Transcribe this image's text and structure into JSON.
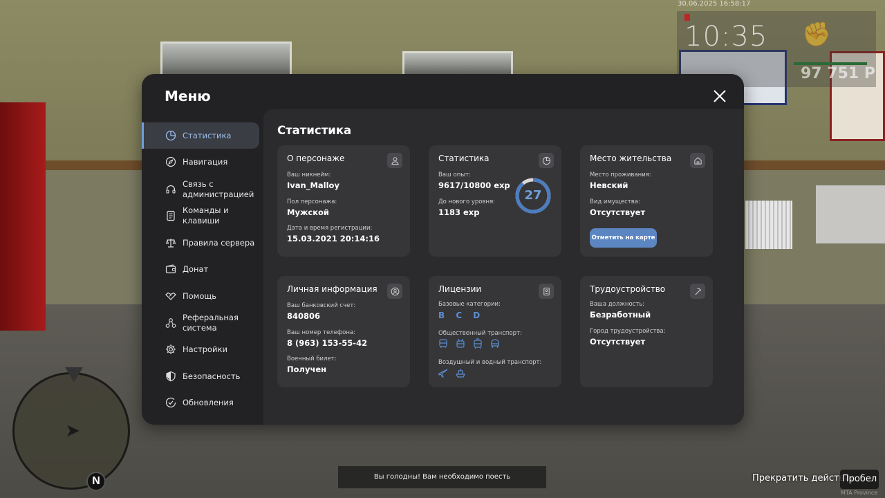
{
  "hud": {
    "timestamp": "30.06.2025 16:58:17",
    "time": "10:35",
    "money": "97 751 Р",
    "compass_letter": "N"
  },
  "menu": {
    "title": "Меню",
    "sidebar": [
      {
        "label": "Статистика",
        "icon": "pie-chart-icon",
        "active": true
      },
      {
        "label": "Навигация",
        "icon": "compass-icon"
      },
      {
        "label": "Связь с администрацией",
        "icon": "headset-icon"
      },
      {
        "label": "Команды и клавиши",
        "icon": "document-icon"
      },
      {
        "label": "Правила сервера",
        "icon": "scales-icon"
      },
      {
        "label": "Донат",
        "icon": "wallet-icon"
      },
      {
        "label": "Помощь",
        "icon": "handshake-icon"
      },
      {
        "label": "Реферальная система",
        "icon": "network-icon"
      },
      {
        "label": "Настройки",
        "icon": "gear-icon"
      },
      {
        "label": "Безопасность",
        "icon": "shield-icon"
      },
      {
        "label": "Обновления",
        "icon": "check-circle-icon"
      }
    ],
    "content_title": "Статистика",
    "cards": {
      "character": {
        "title": "О персонаже",
        "nickname_label": "Ваш никнейм:",
        "nickname": "Ivan_Malloy",
        "gender_label": "Пол персонажа:",
        "gender": "Мужской",
        "reg_label": "Дата и время регистрации:",
        "reg_value": "15.03.2021 20:14:16"
      },
      "stats": {
        "title": "Статистика",
        "exp_label": "Ваш опыт:",
        "exp_value": "9617/10800 exp",
        "next_label": "До нового уровня:",
        "next_value": "1183 exp",
        "level": "27",
        "level_progress": 0.89
      },
      "residence": {
        "title": "Место жительства",
        "place_label": "Место проживания:",
        "place_value": "Невский",
        "property_label": "Вид имущества:",
        "property_value": "Отсутствует",
        "map_button": "Отметить на карте"
      },
      "personal": {
        "title": "Личная информация",
        "bank_label": "Ваш банковский счет:",
        "bank_value": "840806",
        "phone_label": "Ваш номер телефона:",
        "phone_value": "8 (963) 153-55-42",
        "military_label": "Военный билет:",
        "military_value": "Получен"
      },
      "licenses": {
        "title": "Лицензии",
        "base_label": "Базовые категории:",
        "base_value": "B C D",
        "public_label": "Общественный транспорт:",
        "air_label": "Воздушный и водный транспорт:"
      },
      "employment": {
        "title": "Трудоустройство",
        "position_label": "Ваша должность:",
        "position_value": "Безработный",
        "city_label": "Город трудоустройства:",
        "city_value": "Отсутствует"
      }
    }
  },
  "notification": "Вы голодны! Вам необходимо поесть",
  "action": {
    "stop_label": "Прекратить действие",
    "key_label": "Пробел"
  },
  "colors": {
    "accent": "#6f9ed8",
    "panel": "#222225",
    "card": "#363638",
    "button": "#5c86c2"
  }
}
